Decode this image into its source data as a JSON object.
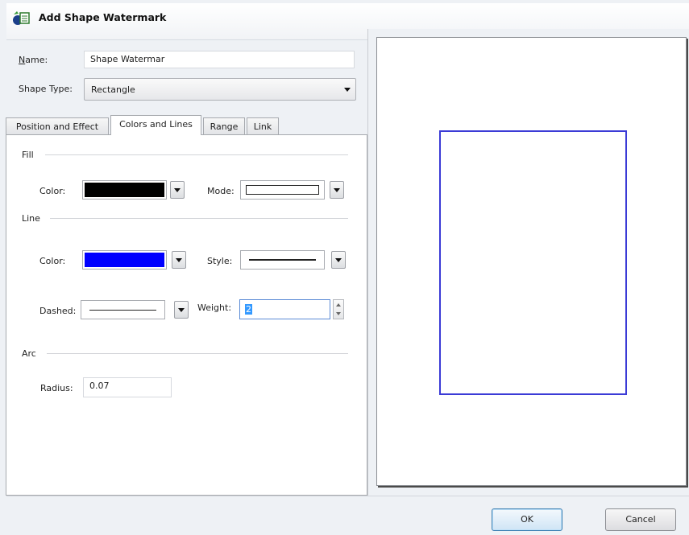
{
  "window": {
    "title": "Add Shape Watermark",
    "icon": "shape-watermark-app-icon"
  },
  "form": {
    "name_label": "Name:",
    "name_value": "Shape Watermar",
    "shape_type_label": "Shape Type:",
    "shape_type_value": "Rectangle"
  },
  "tabs": [
    {
      "label": "Position and Effect",
      "active": false
    },
    {
      "label": "Colors and Lines",
      "active": true
    },
    {
      "label": "Range",
      "active": false
    },
    {
      "label": "Link",
      "active": false
    }
  ],
  "fill": {
    "section_label": "Fill",
    "color_label": "Color:",
    "color_value": "#000000",
    "mode_label": "Mode:"
  },
  "line": {
    "section_label": "Line",
    "color_label": "Color:",
    "color_value": "#0000ff",
    "style_label": "Style:",
    "dashed_label": "Dashed:",
    "weight_label": "Weight:",
    "weight_value": "2"
  },
  "arc": {
    "section_label": "Arc",
    "radius_label": "Radius:",
    "radius_value": "0.07"
  },
  "preview": {
    "border_color": "#3b3bd6"
  },
  "buttons": {
    "ok": "OK",
    "cancel": "Cancel"
  }
}
